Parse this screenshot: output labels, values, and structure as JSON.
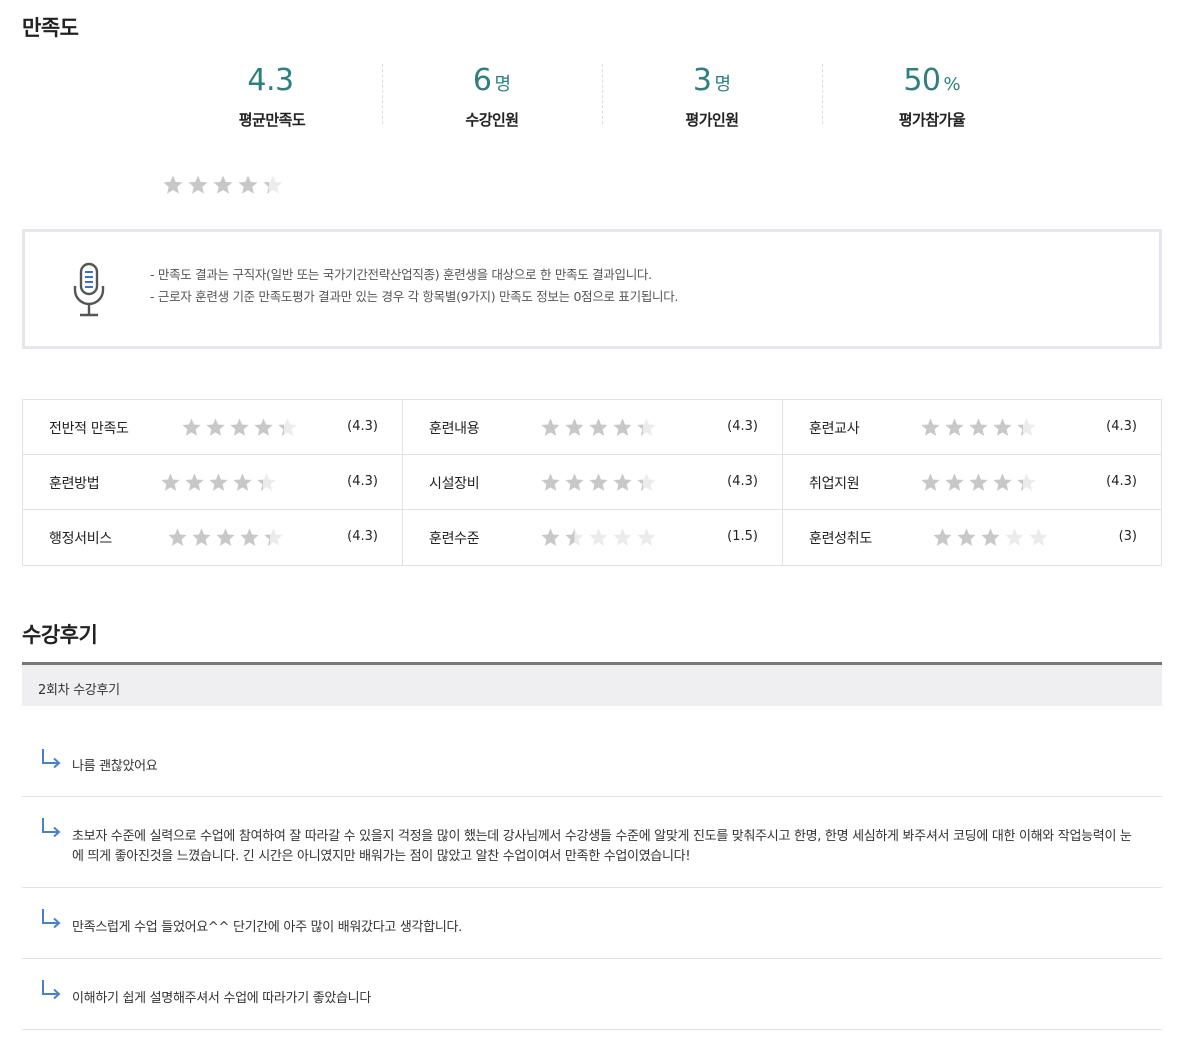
{
  "satisfaction": {
    "title": "만족도",
    "stats": [
      {
        "value": "4.3",
        "unit": "",
        "label": "평균만족도"
      },
      {
        "value": "6",
        "unit": "명",
        "label": "수강인원"
      },
      {
        "value": "3",
        "unit": "명",
        "label": "평가인원"
      },
      {
        "value": "50",
        "unit": "%",
        "label": "평가참가율"
      }
    ],
    "overall_rating": 4.3,
    "max_rating": 5
  },
  "notice": {
    "icon": "microphone-icon",
    "lines": [
      "만족도 결과는 구직자(일반 또는 국가기간전략산업직종) 훈련생을 대상으로 한 만족도 결과입니다.",
      "근로자 훈련생 기준 만족도평가 결과만 있는 경우 각 항목별(9가지) 만족도 정보는 0점으로 표기됩니다."
    ]
  },
  "ratings": [
    {
      "label": "전반적 만족도",
      "rating": 4.3,
      "score_text": "(4.3)"
    },
    {
      "label": "훈련내용",
      "rating": 4.3,
      "score_text": "(4.3)"
    },
    {
      "label": "훈련교사",
      "rating": 4.3,
      "score_text": "(4.3)"
    },
    {
      "label": "훈련방법",
      "rating": 4.3,
      "score_text": "(4.3)"
    },
    {
      "label": "시설장비",
      "rating": 4.3,
      "score_text": "(4.3)"
    },
    {
      "label": "취업지원",
      "rating": 4.3,
      "score_text": "(4.3)"
    },
    {
      "label": "행정서비스",
      "rating": 4.3,
      "score_text": "(4.3)"
    },
    {
      "label": "훈련수준",
      "rating": 1.5,
      "score_text": "(1.5)"
    },
    {
      "label": "훈련성취도",
      "rating": 3,
      "score_text": "(3)"
    }
  ],
  "reviews": {
    "title": "수강후기",
    "group_label": "2회차 수강후기",
    "items": [
      {
        "text": "나름 괜찮았어요"
      },
      {
        "text": "초보자 수준에 실력으로 수업에 참여하여 잘 따라갈 수 있을지 걱정을 많이 했는데 강사님께서 수강생들 수준에 알맞게 진도를 맞춰주시고 한명, 한명 세심하게 봐주셔서 코딩에 대한 이해와 작업능력이 눈에 띄게 좋아진것을 느꼈습니다. 긴 시간은 아니였지만 배워가는 점이 많았고 알찬 수업이여서 만족한 수업이였습니다!"
      },
      {
        "text": "만족스럽게 수업 들었어요^^ 단기간에 아주 많이 배워갔다고 생각합니다."
      },
      {
        "text": "이해하기 쉽게 설명해주셔서 수업에 따라가기 좋았습니다"
      }
    ]
  },
  "colors": {
    "accent": "#2d8080",
    "star": "#c8c8c8",
    "arrow": "#4a7fd0"
  }
}
